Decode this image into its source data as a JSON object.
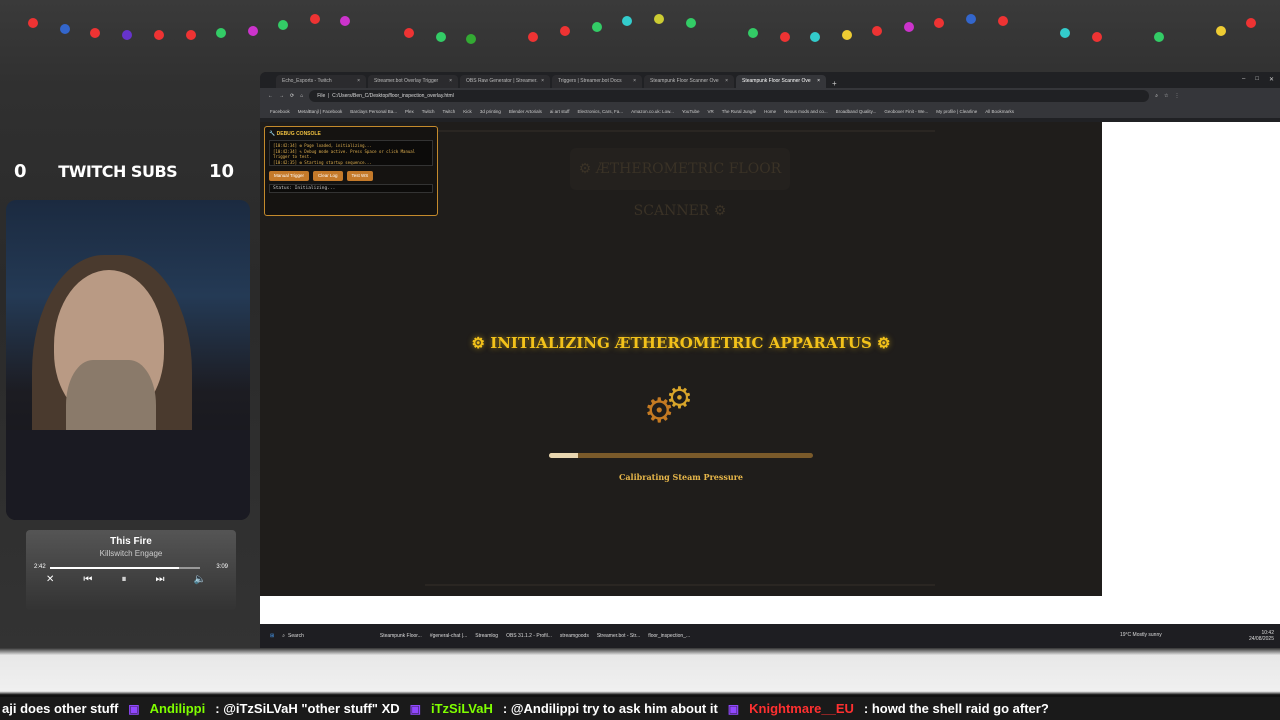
{
  "overlay": {
    "subs": {
      "left_count": "0",
      "title": "TWITCH SUBS",
      "right_count": "10"
    },
    "music": {
      "song": "This Fire",
      "artist": "Killswitch Engage",
      "elapsed": "2:42",
      "duration": "3:09",
      "progress": 0.86
    }
  },
  "browser": {
    "tabs": [
      {
        "label": "Echo_Esports - Twitch",
        "active": false
      },
      {
        "label": "Streamer.bot Overlay Trigger",
        "active": false
      },
      {
        "label": "OBS Raw Generator | Streamer.",
        "active": false
      },
      {
        "label": "Triggers | Streamer.bot Docs",
        "active": false
      },
      {
        "label": "Steampunk Floor Scanner Ove",
        "active": false
      },
      {
        "label": "Steampunk Floor Scanner Ove",
        "active": true
      }
    ],
    "address_prefix": "File",
    "address": "C:/Users/Ben_C/Desktop/floor_inspection_overlay.html",
    "bookmarks": [
      "Facebook",
      "MetalBanjl | Facebook",
      "Barclays Personal Ba...",
      "Plex",
      "Twitch",
      "Twitch",
      "Kick",
      "3d printing",
      "Blender Artorials",
      "ai art stuff",
      "Electronics, Cars, Fa...",
      "Amazon.co.uk: Low...",
      "YouTube",
      "VR",
      "The Rural Jungle",
      "Home",
      "Nexus mods and co...",
      "Broadband Quality...",
      "Geoboxer Finit - We...",
      "My profile | Clearline",
      "All Bookmarks"
    ]
  },
  "debug_console": {
    "title": "DEBUG CONSOLE",
    "log": [
      "[10:42:34] ⚙ Page loaded, initializing...",
      "[10:42:34] ✎ Debug mode active. Press Space or click Manual Trigger to test.",
      "[10:42:35] ⚙ Starting startup sequence..."
    ],
    "buttons": [
      "Manual Trigger",
      "Clear Log",
      "Test WS"
    ],
    "status": "Status: Initializing..."
  },
  "app": {
    "ghost_title": "⚙ ÆTHEROMETRIC FLOOR SCANNER ⚙",
    "init_title": "⚙ INITIALIZING ÆTHEROMETRIC APPARATUS ⚙",
    "progress": 0.11,
    "progress_label": "Calibrating Steam Pressure"
  },
  "taskbar": {
    "search": "Search",
    "items": [
      "Steampunk Floor...",
      "#general-chat |...",
      "Streamlog",
      "OBS 31.1.2 - Profil...",
      "streamgoods",
      "Streamer.bot - Str...",
      "floor_inspection_..."
    ],
    "weather": "19°C Mostly sunny",
    "time": "10:42",
    "date": "24/08/2025"
  },
  "chat": [
    {
      "user": "",
      "text": "aji does other stuff"
    },
    {
      "user": "Andilippi",
      "text": ": @iTzSiLVaH \"other stuff\" XD"
    },
    {
      "user": "iTzSiLVaH",
      "text": ": @Andilippi try to ask him about it"
    },
    {
      "user": "Knightmare__EU",
      "text": ": howd the shell raid go after?"
    }
  ],
  "colors": {
    "accent": "#f3c21a",
    "brass": "#c57a2a",
    "chat_user": "#7fff00",
    "chat_user_alt": "#ff3030"
  }
}
